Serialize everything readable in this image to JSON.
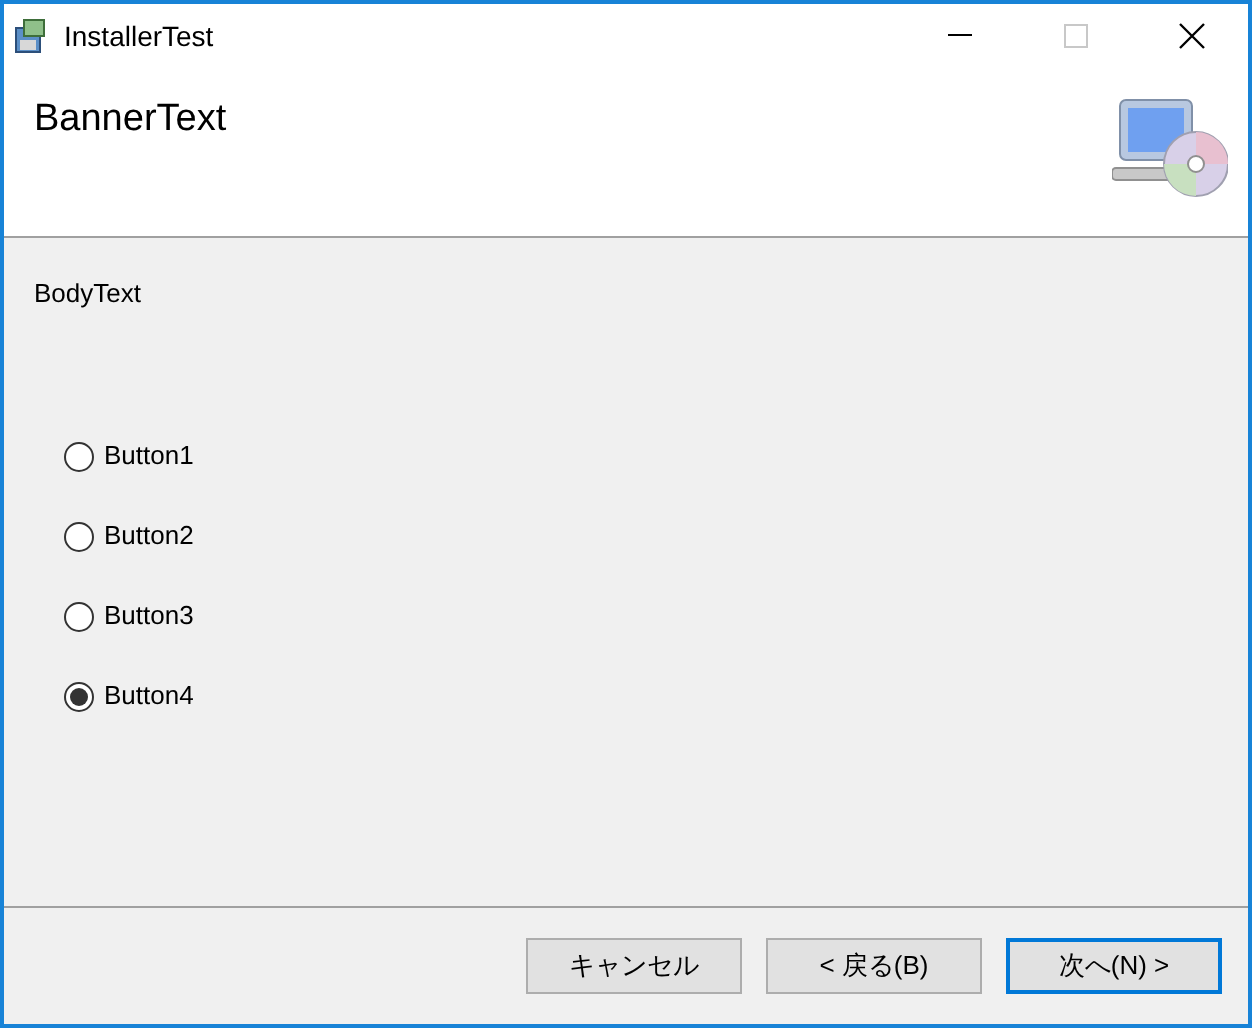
{
  "window": {
    "title": "InstallerTest"
  },
  "banner": {
    "text": "BannerText"
  },
  "body": {
    "text": "BodyText"
  },
  "options": [
    {
      "label": "Button1",
      "selected": false
    },
    {
      "label": "Button2",
      "selected": false
    },
    {
      "label": "Button3",
      "selected": false
    },
    {
      "label": "Button4",
      "selected": true
    }
  ],
  "buttons": [
    {
      "label": "キャンセル",
      "default": false
    },
    {
      "label": "< 戻る(B)",
      "default": false
    },
    {
      "label": "次へ(N) >",
      "default": true
    }
  ]
}
